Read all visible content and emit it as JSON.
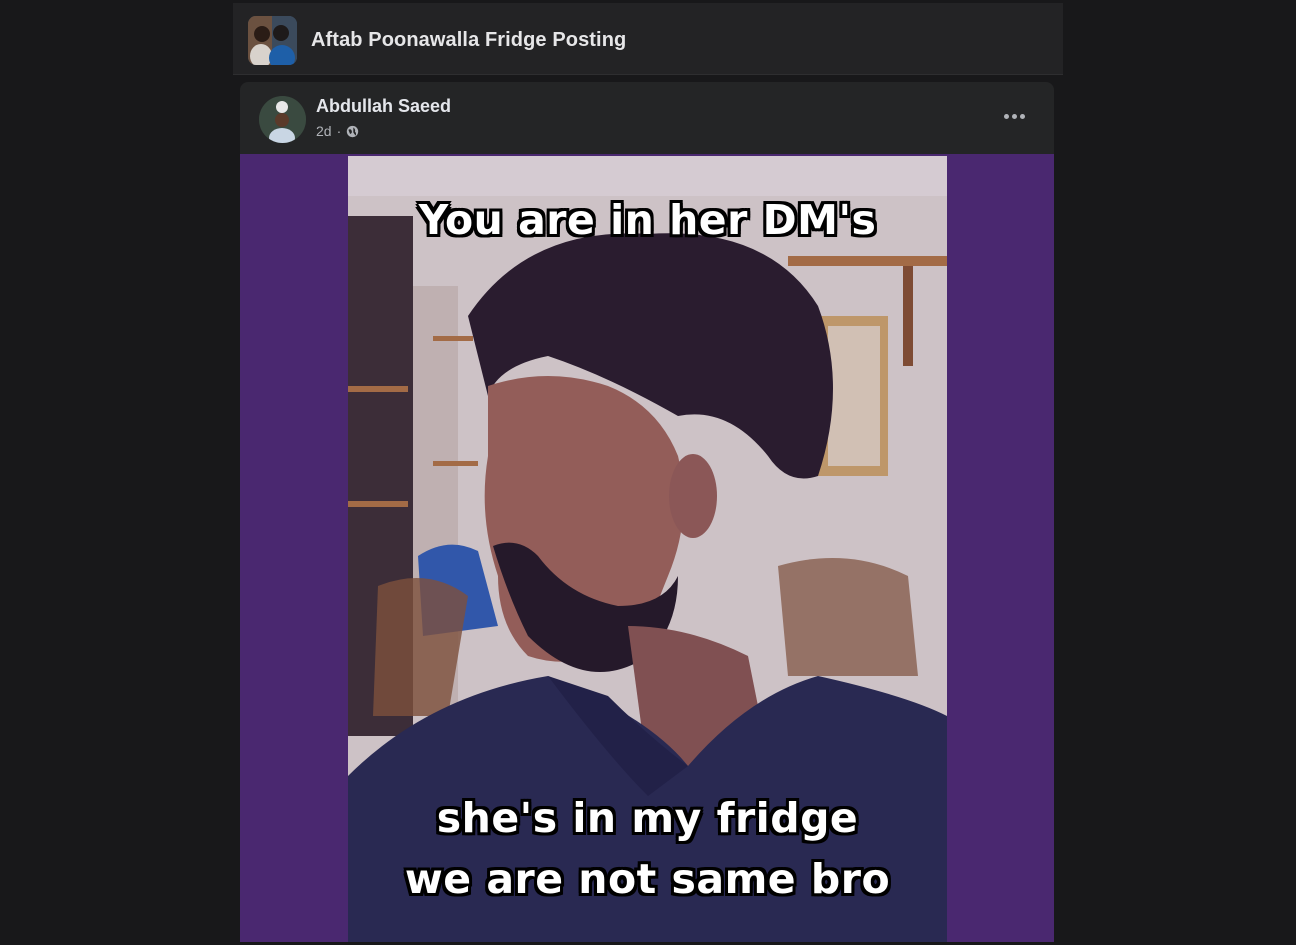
{
  "group": {
    "title": "Aftab Poonawalla Fridge Posting",
    "avatar_icon": "group-photo-icon"
  },
  "post": {
    "author": "Abdullah Saeed",
    "time": "2d",
    "separator": "·",
    "privacy_icon": "globe-icon",
    "more_icon": "more-options-icon",
    "meme": {
      "top_text": "You are in her DM's",
      "bottom_line_1": "she's in my fridge",
      "bottom_line_2": "we are not same bro"
    }
  },
  "colors": {
    "page_bg": "#18181a",
    "card_bg": "#242526",
    "photo_frame": "#4a2870",
    "text_primary": "#e4e6eb",
    "text_secondary": "#b0b3b8"
  }
}
